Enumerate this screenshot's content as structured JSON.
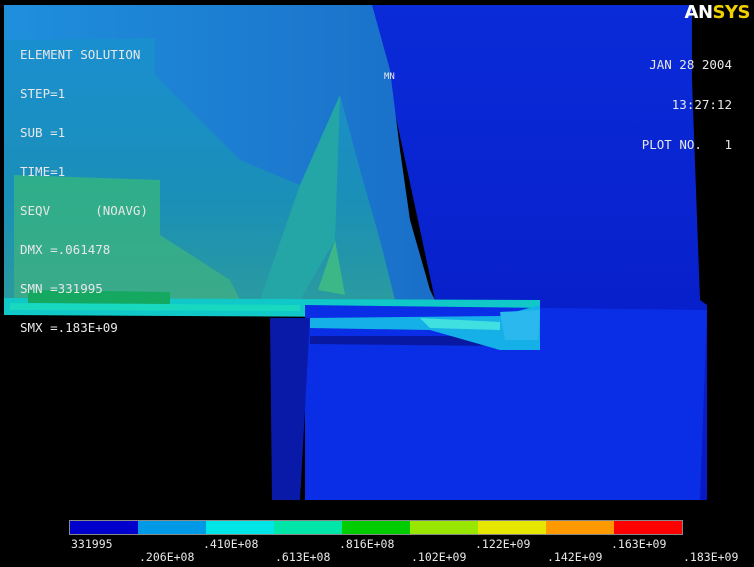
{
  "app": {
    "logo_part1": "AN",
    "logo_part2": "SYS"
  },
  "info": {
    "title": "ELEMENT SOLUTION",
    "step": "STEP=1",
    "sub": "SUB =1",
    "time": "TIME=1",
    "seqv": "SEQV      (NOAVG)",
    "dmx": "DMX =.061478",
    "smn": "SMN =331995",
    "smx": "SMX =.183E+09"
  },
  "header": {
    "date": "JAN 28 2004",
    "time": "13:27:12",
    "plot": "PLOT NO.   1"
  },
  "plot": {
    "min_marker": "MN"
  },
  "legend": {
    "colors": [
      "#0000cc",
      "#0099e6",
      "#00e6e6",
      "#00e6a8",
      "#00cc00",
      "#99e600",
      "#e6e600",
      "#ff9900",
      "#ff0000"
    ],
    "labels_top": [
      "331995",
      ".410E+08",
      ".816E+08",
      ".122E+09",
      ".163E+09"
    ],
    "labels_bottom": [
      ".206E+08",
      ".613E+08",
      ".102E+09",
      ".142E+09",
      ".183E+09"
    ]
  }
}
